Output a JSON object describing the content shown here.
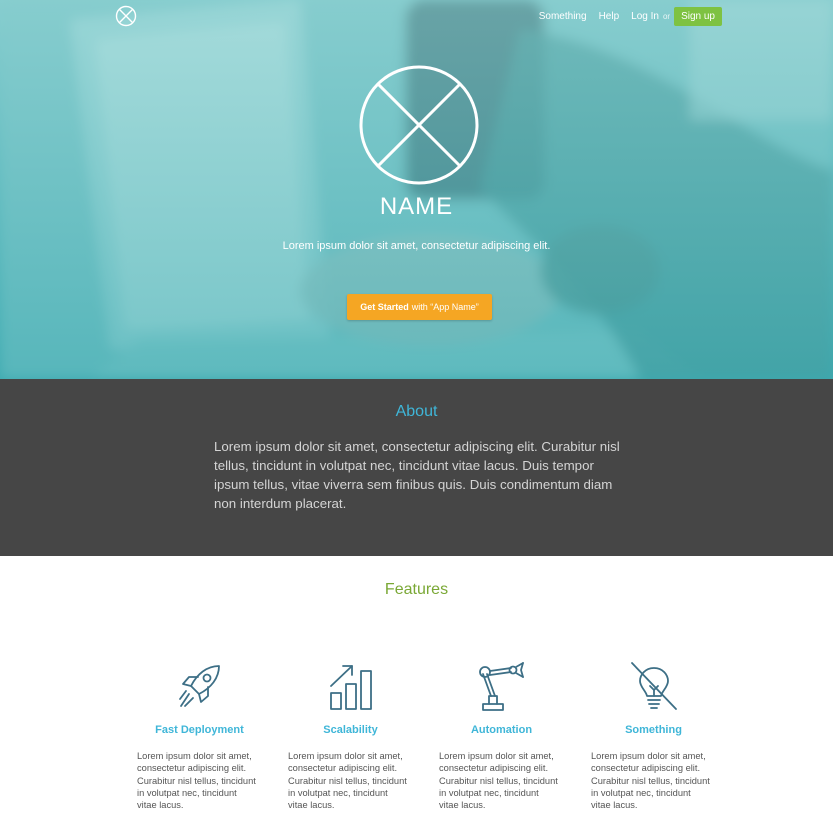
{
  "nav": {
    "links": [
      "Something",
      "Help",
      "Log In"
    ],
    "or_text": "or",
    "signup_label": "Sign up",
    "logo_icon": "circle-x-logo"
  },
  "hero": {
    "title": "NAME",
    "subtitle": "Lorem ipsum dolor sit amet, consectetur adipiscing elit.",
    "cta_strong": "Get Started",
    "cta_rest": "with “App Name”"
  },
  "about": {
    "title": "About",
    "text": "Lorem ipsum dolor sit amet, consectetur adipiscing elit. Curabitur nisl tellus, tincidunt in volutpat nec, tincidunt vitae lacus. Duis tempor ipsum tellus, vitae viverra sem finibus quis. Duis condimentum diam non interdum placerat."
  },
  "features": {
    "title": "Features",
    "items": [
      {
        "title": "Fast Deployment",
        "icon": "rocket-icon",
        "text": "Lorem ipsum dolor sit amet, consectetur adipiscing elit. Curabitur nisl tellus, tincidunt in volutpat nec, tincidunt vitae lacus."
      },
      {
        "title": "Scalability",
        "icon": "growth-chart-icon",
        "text": "Lorem ipsum dolor sit amet, consectetur adipiscing elit. Curabitur nisl tellus, tincidunt in volutpat nec, tincidunt vitae lacus."
      },
      {
        "title": "Automation",
        "icon": "robot-arm-icon",
        "text": "Lorem ipsum dolor sit amet, consectetur adipiscing elit. Curabitur nisl tellus, tincidunt in volutpat nec, tincidunt vitae lacus."
      },
      {
        "title": "Something",
        "icon": "no-idea-bulb-icon",
        "text": "Lorem ipsum dolor sit amet, consectetur adipiscing elit. Curabitur nisl tellus, tincidunt in volutpat nec, tincidunt vitae lacus."
      }
    ]
  },
  "colors": {
    "accent_blue": "#3fb6d8",
    "features_green": "#7aa835",
    "signup_green": "#7ec242",
    "cta_orange": "#f5a623",
    "about_bg": "#464646"
  }
}
